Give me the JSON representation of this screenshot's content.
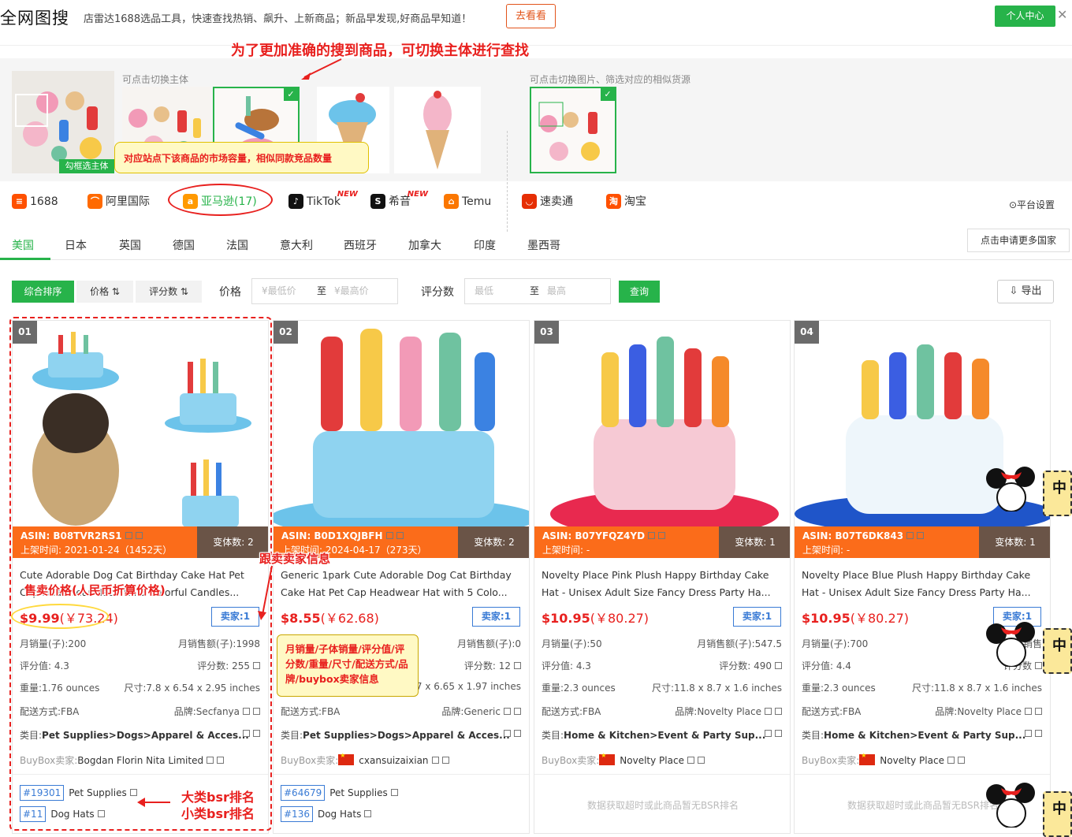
{
  "header": {
    "logo": "全网图搜",
    "slogan": "店雷达1688选品工具，快速查找热销、飙升、上新商品；新品早发现,好商品早知道！",
    "go_button": "去看看",
    "user_center": "个人中心",
    "close": "✕"
  },
  "subject": {
    "switch_hint": "可点击切换主体",
    "frame_tag": "勾框选主体",
    "image_hint": "可点击切换图片、筛选对应的相似货源",
    "check": "✓"
  },
  "annotations": {
    "top_callout": "为了更加准确的搜到商品，可切换主体进行查找",
    "market_note": "对应站点下该商品的市场容量，相似同款竞品数量",
    "seller_info": "跟卖卖家信息",
    "price_note": "售卖价格(人民币折算价格)",
    "metrics_note": "月销量/子体销量/评分值/评分数/重量/尺寸/配送方式/品牌/buybox卖家信息",
    "bsr_big": "大类bsr排名",
    "bsr_small": "小类bsr排名"
  },
  "platforms": {
    "items": [
      {
        "label": "1688",
        "icon": "1688-icon",
        "color": "#ff5000",
        "glyph": "≡"
      },
      {
        "label": "阿里国际",
        "icon": "alibaba-icon",
        "color": "#ff6a00",
        "glyph": "⌒"
      },
      {
        "label": "亚马逊(17)",
        "icon": "amazon-icon",
        "color": "#ff9900",
        "glyph": "a"
      },
      {
        "label": "TikTok",
        "icon": "tiktok-icon",
        "color": "#111111",
        "glyph": "♪",
        "badge": "NEW"
      },
      {
        "label": "希音",
        "icon": "shein-icon",
        "color": "#111111",
        "glyph": "S",
        "badge": "NEW"
      },
      {
        "label": "Temu",
        "icon": "temu-icon",
        "color": "#fb7701",
        "glyph": "⌂"
      },
      {
        "label": "速卖通",
        "icon": "aliexpress-icon",
        "color": "#e62e04",
        "glyph": "◡"
      },
      {
        "label": "淘宝",
        "icon": "taobao-icon",
        "color": "#ff5000",
        "glyph": "淘"
      }
    ],
    "settings": "⊙平台设置"
  },
  "countries": {
    "items": [
      "美国",
      "日本",
      "英国",
      "德国",
      "法国",
      "意大利",
      "西班牙",
      "加拿大",
      "印度",
      "墨西哥"
    ],
    "active": "美国",
    "apply": "点击申请更多国家"
  },
  "filters": {
    "sort_default": "综合排序",
    "sort_price": "价格 ⇅",
    "sort_reviews": "评分数 ⇅",
    "price_label": "价格",
    "price_min_placeholder": "¥最低价",
    "to": "至",
    "price_max_placeholder": "¥最高价",
    "reviews_label": "评分数",
    "reviews_min_placeholder": "最低",
    "reviews_max_placeholder": "最高",
    "query": "查询",
    "export": "⇩ 导出"
  },
  "products": [
    {
      "num": "01",
      "asin": "ASIN: B08TVR2RS1",
      "date": "上架时间:   2021-01-24（1452天）",
      "variants": "变体数: 2",
      "title1": "Cute Adorable Dog Cat Birthday Cake Hat Pet",
      "title2": "Cap Headwear Hat with 5 Colorful Candles...",
      "price": "$9.99",
      "cny": "(￥73.24)",
      "seller": "卖家:1",
      "sales": "月销量(子):200",
      "revenue": "月销售额(子):1998",
      "rating": "评分值: 4.3",
      "reviews": "评分数:  255",
      "weight": "重量:1.76 ounces",
      "size": "尺寸:7.8 x 6.54 x 2.95 inches",
      "ship": "配送方式:FBA",
      "brand": "品牌:Secfanya",
      "cat_label": "类目:",
      "category": "Pet Supplies>Dogs>Apparel & Acces...",
      "buybox_label": "BuyBox卖家:",
      "buybox": "Bogdan Florin Nita Limited",
      "flag": false,
      "bsr": [
        {
          "rank": "#19301",
          "name": "Pet Supplies"
        },
        {
          "rank": "#11",
          "name": "Dog Hats"
        }
      ]
    },
    {
      "num": "02",
      "asin": "ASIN: B0D1XQJBFH",
      "date": "上架时间:   2024-04-17（273天）",
      "variants": "变体数: 2",
      "title1": "Generic 1park Cute Adorable Dog Cat Birthday",
      "title2": "Cake Hat Pet Cap Headwear Hat with 5 Colo...",
      "price": "$8.55",
      "cny": "(￥62.68)",
      "seller": "卖家:1",
      "sales": "",
      "revenue": "月销售额(子):0",
      "rating": "",
      "reviews": "评分数:  12",
      "weight": "",
      "size": "07 x 6.65 x 1.97 inches",
      "ship": "配送方式:FBA",
      "brand": "品牌:Generic",
      "cat_label": "类目:",
      "category": "Pet Supplies>Dogs>Apparel & Acces...",
      "buybox_label": "BuyBox卖家:",
      "buybox": "cxansuizaixian",
      "flag": true,
      "bsr": [
        {
          "rank": "#64679",
          "name": "Pet Supplies"
        },
        {
          "rank": "#136",
          "name": "Dog Hats"
        }
      ]
    },
    {
      "num": "03",
      "asin": "ASIN: B07YFQZ4YD",
      "date": "上架时间:   -",
      "variants": "变体数: 1",
      "title1": "Novelty Place Pink Plush Happy Birthday Cake",
      "title2": "Hat - Unisex Adult Size Fancy Dress Party Ha...",
      "price": "$10.95",
      "cny": "(￥80.27)",
      "seller": "卖家:1",
      "sales": "月销量(子):50",
      "revenue": "月销售额(子):547.5",
      "rating": "评分值: 4.3",
      "reviews": "评分数:  490",
      "weight": "重量:2.3 ounces",
      "size": "尺寸:11.8 x 8.7 x 1.6 inches",
      "ship": "配送方式:FBA",
      "brand": "品牌:Novelty Place",
      "cat_label": "类目:",
      "category": "Home & Kitchen>Event & Party Sup...",
      "buybox_label": "BuyBox卖家:",
      "buybox": "Novelty Place",
      "flag": true,
      "no_bsr": "数据获取超时或此商品暂无BSR排名"
    },
    {
      "num": "04",
      "asin": "ASIN: B07T6DK843",
      "date": "上架时间:   -",
      "variants": "变体数: 1",
      "title1": "Novelty Place Blue Plush Happy Birthday Cake",
      "title2": "Hat - Unisex Adult Size Fancy Dress Party Ha...",
      "price": "$10.95",
      "cny": "(￥80.27)",
      "seller": "卖家:1",
      "sales": "月销量(子):700",
      "revenue": "月销售",
      "rating": "评分值: 4.4",
      "reviews": "评分数",
      "weight": "重量:2.3 ounces",
      "size": "尺寸:11.8 x 8.7 x 1.6 inches",
      "ship": "配送方式:FBA",
      "brand": "品牌:Novelty Place",
      "cat_label": "类目:",
      "category": "Home & Kitchen>Event & Party Sup...",
      "buybox_label": "BuyBox卖家:",
      "buybox": "Novelty Place",
      "flag": true,
      "no_bsr": "数据获取超时或此商品暂无BSR排名"
    }
  ],
  "side_widget": "中",
  "colors": {
    "accent": "#27b34a",
    "price": "#e8201e",
    "band": "#fb6c1a",
    "link": "#3a7bd5"
  }
}
